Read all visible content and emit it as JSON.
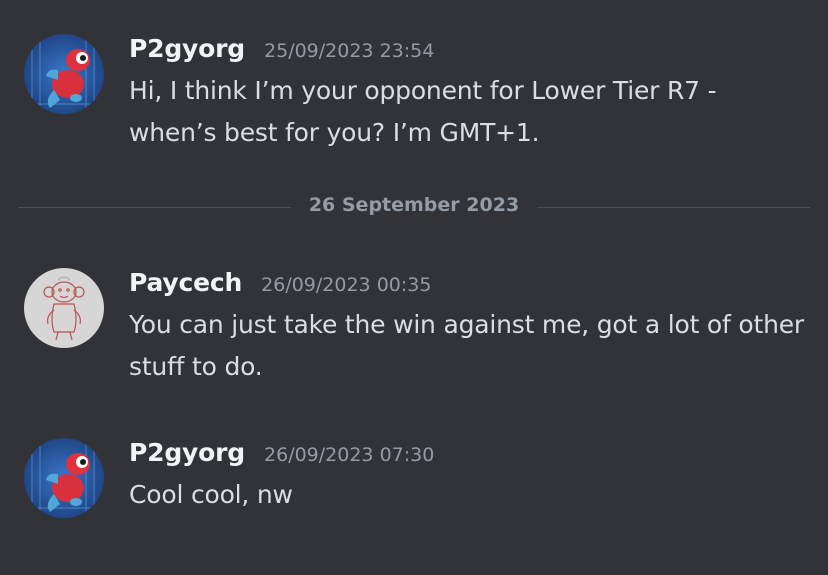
{
  "messages": [
    {
      "username": "P2gyorg",
      "timestamp": "25/09/2023 23:54",
      "text": "Hi, I think I’m your opponent for Lower Tier R7 - when’s best for you? I’m GMT+1."
    },
    {
      "username": "Paycech",
      "timestamp": "26/09/2023 00:35",
      "text": "You can just take the win against me, got a lot of other stuff to do."
    },
    {
      "username": "P2gyorg",
      "timestamp": "26/09/2023 07:30",
      "text": "Cool cool, nw"
    }
  ],
  "divider": {
    "label": "26 September 2023"
  },
  "colors": {
    "background": "#313338",
    "username": "#f2f3f5",
    "timestamp": "#949ba4",
    "text": "#dbdee1",
    "divider": "#4e5058"
  }
}
